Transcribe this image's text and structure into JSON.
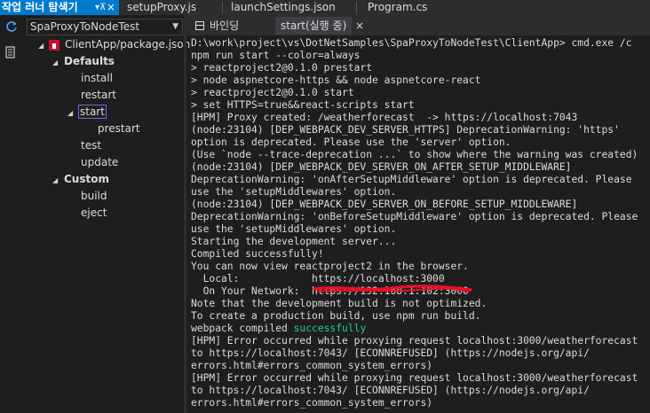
{
  "doc_tabs": {
    "panel_title": "작업 러너 탐색기",
    "pin_glyph": "▾ ⊼",
    "close_glyph": "×",
    "tabs": [
      "setupProxy.js",
      "launchSettings.json",
      "Program.cs"
    ]
  },
  "left_panel": {
    "project_combo": "SpaProxyToNodeTest",
    "tree": {
      "root": "ClientApp/package.json",
      "defaults_label": "Defaults",
      "defaults": [
        "install",
        "restart",
        "start",
        "prestart",
        "test",
        "update"
      ],
      "custom_label": "Custom",
      "custom": [
        "build",
        "eject"
      ]
    }
  },
  "terminal_tabs": {
    "binding": "바인딩",
    "start_tab": "start(실행 중)",
    "close_glyph": "×"
  },
  "terminal": {
    "lines": [
      "D:\\work\\project\\vs\\DotNetSamples\\SpaProxyToNodeTest\\ClientApp> cmd.exe /c",
      "npm run start --color=always",
      "> reactproject2@0.1.0 prestart",
      "> node aspnetcore-https && node aspnetcore-react",
      "> reactproject2@0.1.0 start",
      "> set HTTPS=true&&react-scripts start",
      "[HPM] Proxy created: /weatherforecast  -> https://localhost:7043",
      "(node:23104) [DEP_WEBPACK_DEV_SERVER_HTTPS] DeprecationWarning: 'https'",
      "option is deprecated. Please use the 'server' option.",
      "(Use `node --trace-deprecation ...` to show where the warning was created)",
      "(node:23104) [DEP_WEBPACK_DEV_SERVER_ON_AFTER_SETUP_MIDDLEWARE]",
      "DeprecationWarning: 'onAfterSetupMiddleware' option is deprecated. Please",
      "use the 'setupMiddlewares' option.",
      "(node:23104) [DEP_WEBPACK_DEV_SERVER_ON_BEFORE_SETUP_MIDDLEWARE]",
      "DeprecationWarning: 'onBeforeSetupMiddleware' option is deprecated. Please",
      "use the 'setupMiddlewares' option.",
      "Starting the development server...",
      "Compiled successfully!",
      "You can now view reactproject2 in the browser.",
      "  Local:            https://localhost:3000",
      "  On Your Network:  https://192.168.1.102:3000",
      "Note that the development build is not optimized.",
      "To create a production build, use npm run build.",
      "webpack compiled ",
      "[HPM] Error occurred while proxying request localhost:3000/weatherforecast",
      "to https://localhost:7043/ [ECONNREFUSED] (https://nodejs.org/api/",
      "errors.html#errors_common_system_errors)",
      "[HPM] Error occurred while proxying request localhost:3000/weatherforecast",
      "to https://localhost:7043/ [ECONNREFUSED] (https://nodejs.org/api/",
      "errors.html#errors_common_system_errors)"
    ],
    "success_word": "successfully"
  },
  "colors": {
    "accent": "#007acc",
    "success": "#23d18b",
    "annotation": "#e81123",
    "package_icon": "#c8102e"
  }
}
